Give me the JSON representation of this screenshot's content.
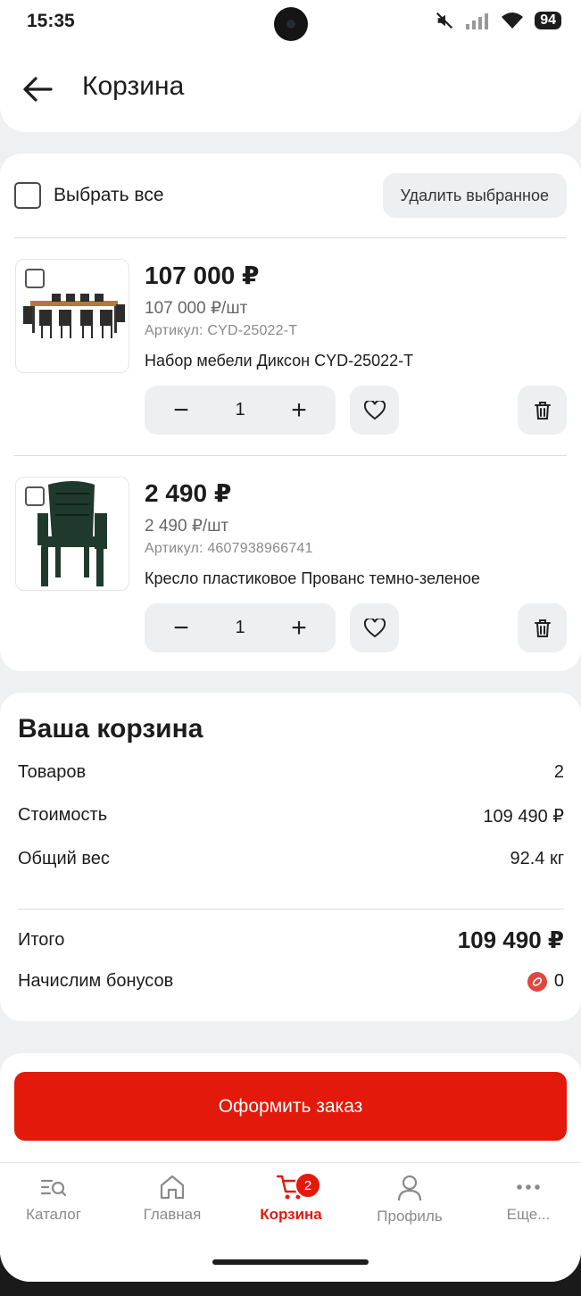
{
  "status_bar": {
    "time": "15:35",
    "battery": "94"
  },
  "header": {
    "title": "Корзина"
  },
  "cart": {
    "select_all_label": "Выбрать все",
    "delete_selected_label": "Удалить выбранное",
    "items": [
      {
        "price": "107 000 ₽",
        "unit_price": "107 000 ₽/шт",
        "sku": "Артикул: CYD-25022-T",
        "name": "Набор мебели Диксон CYD-25022-T",
        "quantity": "1"
      },
      {
        "price": "2 490 ₽",
        "unit_price": "2 490 ₽/шт",
        "sku": "Артикул: 4607938966741",
        "name": "Кресло пластиковое Прованс темно-зеленое",
        "quantity": "1"
      }
    ]
  },
  "summary": {
    "title": "Ваша корзина",
    "items_label": "Товаров",
    "items_value": "2",
    "cost_label": "Стоимость",
    "cost_value": "109 490 ₽",
    "weight_label": "Общий вес",
    "weight_value": "92.4 кг",
    "total_label": "Итого",
    "total_value": "109 490 ₽",
    "bonus_label": "Начислим бонусов",
    "bonus_value": "0"
  },
  "checkout": {
    "label": "Оформить заказ"
  },
  "bottom_nav": {
    "items": [
      {
        "label": "Каталог",
        "icon": "catalog-icon"
      },
      {
        "label": "Главная",
        "icon": "home-icon"
      },
      {
        "label": "Корзина",
        "icon": "cart-icon",
        "badge": "2"
      },
      {
        "label": "Профиль",
        "icon": "profile-icon"
      },
      {
        "label": "Еще...",
        "icon": "more-icon"
      }
    ]
  },
  "colors": {
    "accent": "#e3190b",
    "background": "#eff0f2",
    "card": "#ffffff"
  }
}
